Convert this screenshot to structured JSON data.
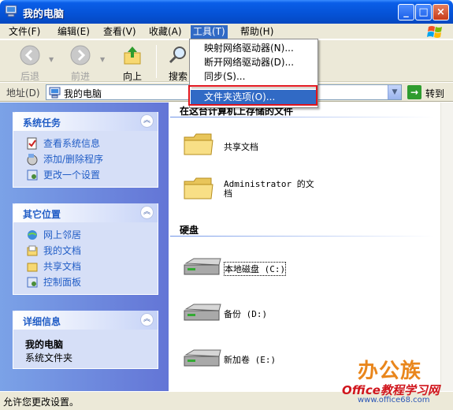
{
  "window": {
    "title": "我的电脑"
  },
  "menubar": {
    "items": [
      "文件(F)",
      "编辑(E)",
      "查看(V)",
      "收藏(A)",
      "工具(T)",
      "帮助(H)"
    ]
  },
  "toolbar": {
    "back_label": "后退",
    "forward_label": "前进",
    "up_label": "向上",
    "search_label": "搜索"
  },
  "address": {
    "label": "地址(D)",
    "value": "我的电脑",
    "go_label": "转到"
  },
  "tools_menu": {
    "items": [
      "映射网络驱动器(N)...",
      "断开网络驱动器(D)...",
      "同步(S)...",
      "文件夹选项(O)..."
    ],
    "highlighted_index": 3
  },
  "left_panels": {
    "system_tasks": {
      "title": "系统任务",
      "items": [
        "查看系统信息",
        "添加/删除程序",
        "更改一个设置"
      ]
    },
    "other_places": {
      "title": "其它位置",
      "items": [
        "网上邻居",
        "我的文档",
        "共享文档",
        "控制面板"
      ]
    },
    "details": {
      "title": "详细信息",
      "name": "我的电脑",
      "subtitle": "系统文件夹"
    }
  },
  "content": {
    "files_group_title": "在这台计算机上存储的文件",
    "folders": [
      "共享文档",
      "Administrator 的文档"
    ],
    "drives_group_title": "硬盘",
    "drives": [
      "本地磁盘 (C:)",
      "备份 (D:)",
      "新加卷 (E:)"
    ]
  },
  "statusbar": {
    "text": "允许您更改设置。"
  },
  "watermark": {
    "brand": "办公族",
    "line1": "Office教程学习网",
    "line2": "www.office68.com"
  },
  "colors": {
    "titlebar": "#0552d6",
    "menu_highlight": "#316ac5",
    "task_link": "#215dc6",
    "red_box": "#e0141c"
  }
}
